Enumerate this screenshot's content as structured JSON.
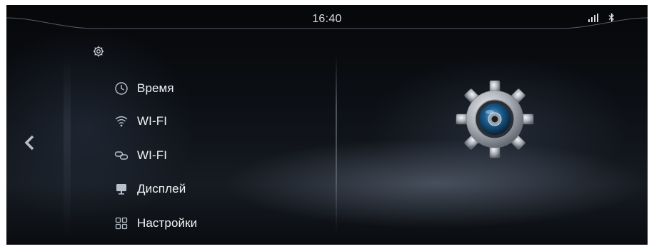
{
  "status_bar": {
    "time": "16:40",
    "signal_icon": "signal-icon",
    "bluetooth_icon": "bluetooth-icon"
  },
  "header": {
    "settings_icon": "gear-icon"
  },
  "navigation": {
    "back_icon": "chevron-left-icon"
  },
  "menu": {
    "items": [
      {
        "label": "Время",
        "icon": "clock-icon"
      },
      {
        "label": "WI-FI",
        "icon": "wifi-icon"
      },
      {
        "label": "WI-FI",
        "icon": "link-icon"
      },
      {
        "label": "Дисплей",
        "icon": "display-icon"
      },
      {
        "label": "Настройки",
        "icon": "grid-icon"
      }
    ]
  },
  "illustration": {
    "icon": "settings-gear-illustration"
  },
  "colors": {
    "text": "#f2f4f7",
    "icon": "#b9c0ca",
    "background": "#0c0f14"
  }
}
